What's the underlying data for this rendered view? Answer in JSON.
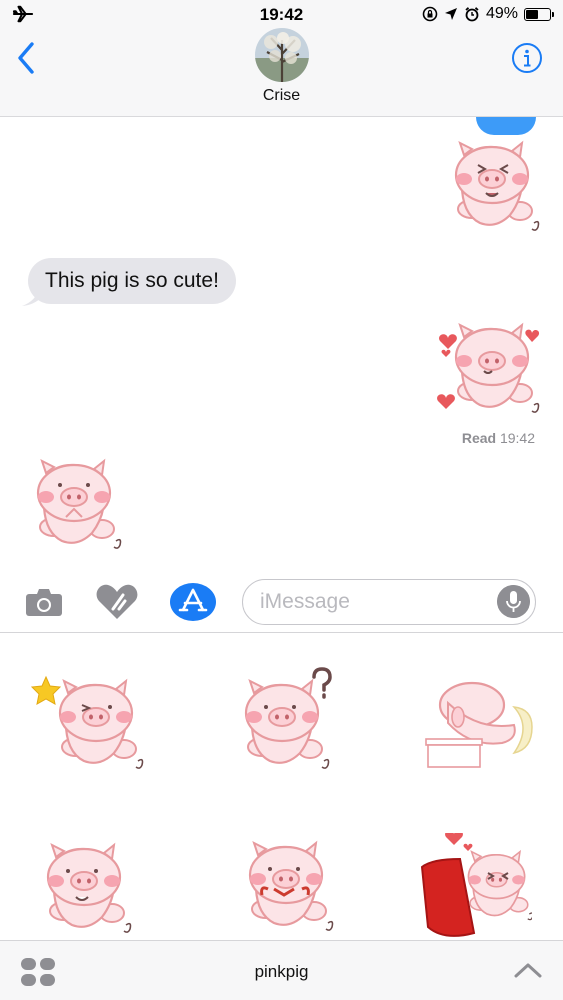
{
  "status_bar": {
    "time": "19:42",
    "battery_percent": "49%",
    "battery_level": 0.49,
    "icons": [
      "airplane-icon",
      "screen-lock-icon",
      "location-arrow-icon",
      "alarm-icon",
      "battery-icon"
    ]
  },
  "header": {
    "contact_name": "Crise",
    "back_icon": "chevron-left-icon",
    "info_icon": "info-icon"
  },
  "conversation": {
    "messages": [
      {
        "direction": "outgoing",
        "type": "sticker",
        "sticker": "pig-laughing"
      },
      {
        "direction": "incoming",
        "type": "text",
        "text": "This pig is so cute!"
      },
      {
        "direction": "outgoing",
        "type": "sticker",
        "sticker": "pig-hearts"
      },
      {
        "direction": "incoming",
        "type": "sticker",
        "sticker": "pig-clapping"
      }
    ],
    "read_label": "Read",
    "read_time": "19:42"
  },
  "input_bar": {
    "placeholder": "iMessage",
    "icons": [
      "camera-icon",
      "digital-touch-icon",
      "app-store-icon",
      "microphone-icon"
    ]
  },
  "sticker_drawer": {
    "pack_name": "pinkpig",
    "stickers": [
      "pig-star-wink",
      "pig-question",
      "pig-sleeping-desk",
      "pig-drooling",
      "pig-ribbon",
      "pig-red-blanket-hearts"
    ]
  },
  "colors": {
    "accent_blue": "#1a7cf5",
    "bubble_gray": "#e5e5ea",
    "pig_pink": "#fbe1e4",
    "pig_outline": "#e79a9e",
    "cheek": "#f6a4b0"
  }
}
